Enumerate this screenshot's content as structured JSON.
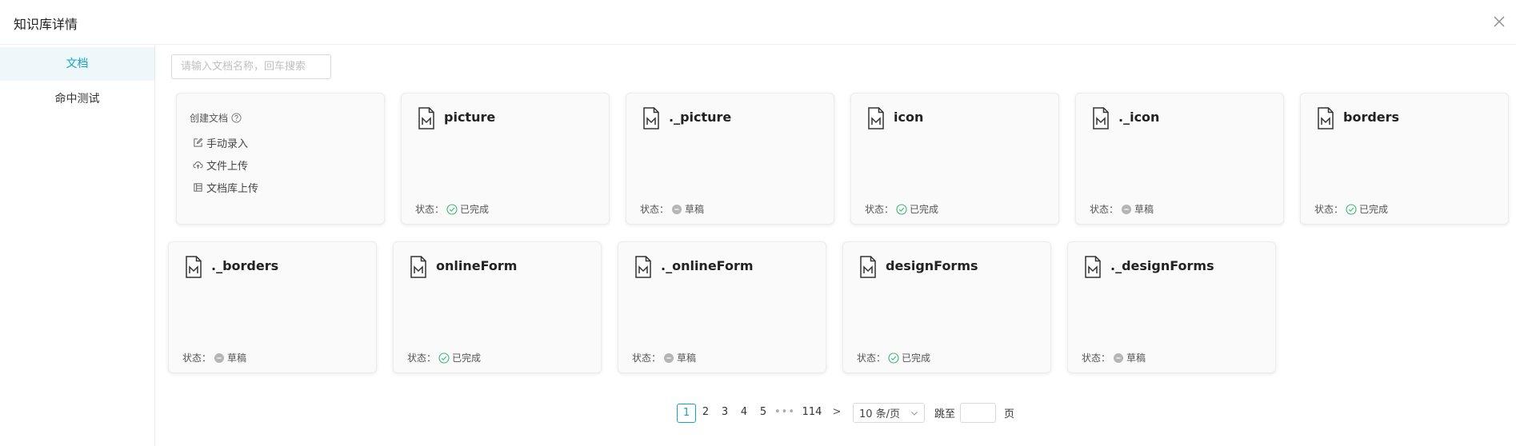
{
  "header": {
    "title": "知识库详情"
  },
  "sidebar": {
    "items": [
      {
        "label": "文档"
      },
      {
        "label": "命中测试"
      }
    ]
  },
  "search": {
    "placeholder": "请输入文档名称，回车搜索"
  },
  "create": {
    "title": "创建文档",
    "options": [
      {
        "label": "手动录入",
        "icon": "edit-icon"
      },
      {
        "label": "文件上传",
        "icon": "cloud-upload-icon"
      },
      {
        "label": "文档库上传",
        "icon": "library-icon"
      }
    ]
  },
  "status_prefix": "状态：",
  "documents": [
    {
      "name": "picture",
      "status": "已完成",
      "state": "done"
    },
    {
      "name": "._picture",
      "status": "草稿",
      "state": "draft"
    },
    {
      "name": "icon",
      "status": "已完成",
      "state": "done"
    },
    {
      "name": "._icon",
      "status": "草稿",
      "state": "draft"
    },
    {
      "name": "borders",
      "status": "已完成",
      "state": "done"
    },
    {
      "name": "._borders",
      "status": "草稿",
      "state": "draft"
    },
    {
      "name": "onlineForm",
      "status": "已完成",
      "state": "done"
    },
    {
      "name": "._onlineForm",
      "status": "草稿",
      "state": "draft"
    },
    {
      "name": "designForms",
      "status": "已完成",
      "state": "done"
    },
    {
      "name": "._designForms",
      "status": "草稿",
      "state": "draft"
    }
  ],
  "pagination": {
    "pages": [
      "1",
      "2",
      "3",
      "4",
      "5"
    ],
    "ellipsis": "•••",
    "last": "114",
    "next": ">",
    "current": "1",
    "page_size": "10 条/页",
    "jump_label": "跳至",
    "jump_unit": "页"
  },
  "colors": {
    "accent": "#14a4c4",
    "done": "#3cb878",
    "draft": "#b5b5b5"
  }
}
